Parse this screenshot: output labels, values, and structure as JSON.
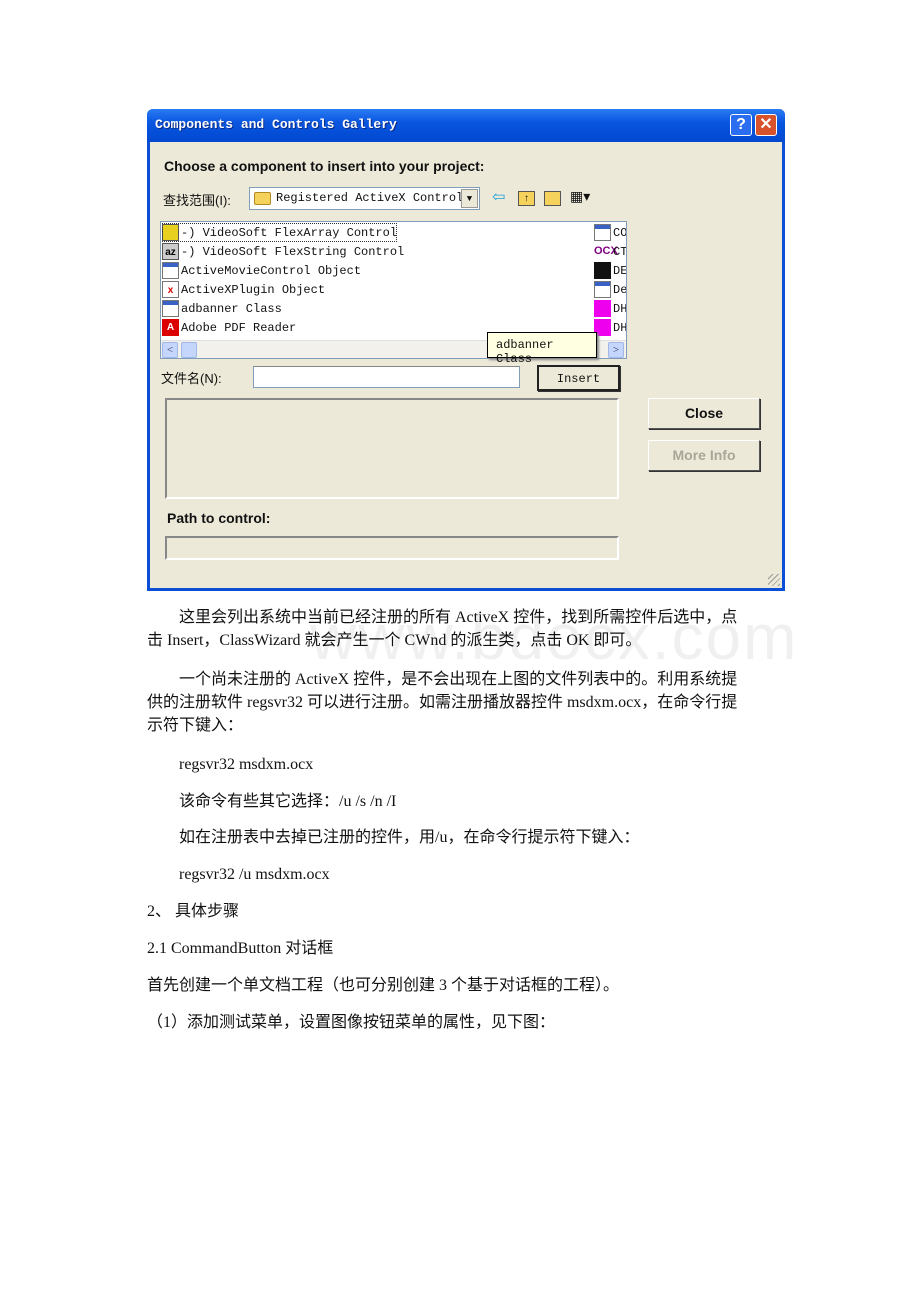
{
  "dialog": {
    "title": "Components and Controls Gallery",
    "help_label": "?",
    "close_label": "✕",
    "heading": "Choose a component to insert into your project:",
    "lookin_label": "查找范围(I):",
    "lookin_value": "Registered ActiveX Controls",
    "toolbar_icons": [
      "back-arrow-icon",
      "up-folder-icon",
      "new-folder-icon",
      "view-menu-icon"
    ],
    "list_items": [
      {
        "label": "-) VideoSoft FlexArray Control",
        "icon": "grid"
      },
      {
        "label": "-) VideoSoft FlexString Control",
        "icon": "az"
      },
      {
        "label": "ActiveMovieControl Object",
        "icon": "generic"
      },
      {
        "label": "ActiveXPlugin Object",
        "icon": "x"
      },
      {
        "label": "adbanner Class",
        "icon": "generic"
      },
      {
        "label": "Adobe PDF Reader",
        "icon": "adobe"
      }
    ],
    "list_items_col2": [
      {
        "label": "CO",
        "icon": "generic"
      },
      {
        "label": "CT",
        "icon": "ocx"
      },
      {
        "label": "DE",
        "icon": "black"
      },
      {
        "label": "De",
        "icon": "generic"
      },
      {
        "label": "DH",
        "icon": "magenta"
      },
      {
        "label": "DH",
        "icon": "magenta"
      }
    ],
    "tooltip": "adbanner Class",
    "filename_label": "文件名(N):",
    "filename_value": "",
    "insert_label": "Insert",
    "close_button": "Close",
    "more_info_button": "More Info",
    "path_label": "Path to control:",
    "path_value": ""
  },
  "body": {
    "para1": [
      "这里会列出系统中当前已经注册的所有 ActiveX 控件，找到所需控件后选中，点",
      "击 Insert，ClassWizard 就会产生一个 CWnd 的派生类，点击 OK 即可。"
    ],
    "para2": [
      "一个尚未注册的 ActiveX 控件，是不会出现在上图的文件列表中的。利用系统提",
      "供的注册软件 regsvr32 可以进行注册。如需注册播放器控件 msdxm.ocx，在命令行提",
      "示符下键入："
    ],
    "cmd1": "regsvr32 msdxm.ocx",
    "options": "该命令有些其它选择：/u /s /n /I",
    "unregister": "如在注册表中去掉已注册的控件，用/u，在命令行提示符下键入：",
    "cmd2": "regsvr32 /u msdxm.ocx",
    "section2": "2、 具体步骤",
    "section21": "2.1 CommandButton 对话框",
    "step_intro": "首先创建一个单文档工程（也可分别创建 3 个基于对话框的工程）。",
    "step1": "（1）添加测试菜单，设置图像按钮菜单的属性，见下图："
  },
  "watermark": "www.bdocx.com"
}
